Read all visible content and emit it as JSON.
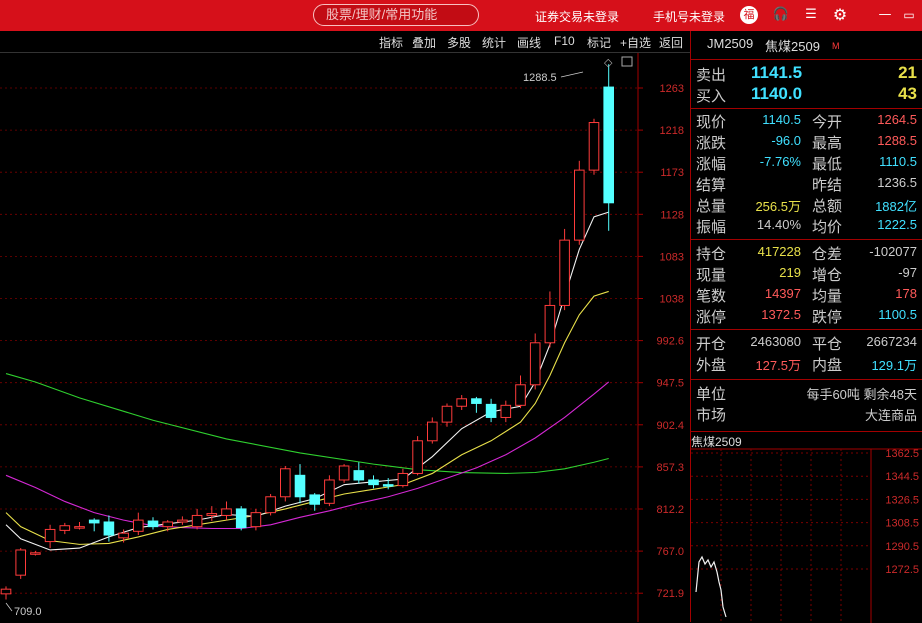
{
  "top": {
    "search": "股票/理财/常用功能",
    "link1": "证券交易未登录",
    "link2": "手机号未登录"
  },
  "toolbar": [
    "指标",
    "叠加",
    "多股",
    "统计",
    "画线",
    "F10",
    "标记",
    "+自选",
    "返回"
  ],
  "kchart": {
    "price_axis": [
      "1263",
      "1218",
      "1173",
      "1128",
      "1083",
      "1038",
      "992.6",
      "947.5",
      "902.4",
      "857.3",
      "812.2",
      "767.0",
      "721.9"
    ],
    "high_label": "1288.5",
    "low_label": "709.0",
    "candles": [
      [
        0,
        721,
        726,
        715,
        729
      ],
      [
        1,
        741,
        768,
        737,
        770
      ],
      [
        2,
        765,
        765,
        762,
        767
      ],
      [
        3,
        777,
        790,
        770,
        795
      ],
      [
        4,
        789,
        794,
        785,
        797
      ],
      [
        5,
        793,
        793,
        790,
        798
      ],
      [
        6,
        800,
        797,
        788,
        802
      ],
      [
        7,
        798,
        784,
        777,
        805
      ],
      [
        8,
        781,
        786,
        776,
        790
      ],
      [
        9,
        788,
        800,
        784,
        808
      ],
      [
        10,
        799,
        793,
        790,
        803
      ],
      [
        11,
        793,
        798,
        788,
        800
      ],
      [
        12,
        798,
        800,
        795,
        804
      ],
      [
        13,
        793,
        805,
        790,
        812
      ],
      [
        14,
        805,
        807,
        799,
        815
      ],
      [
        15,
        805,
        812,
        800,
        820
      ],
      [
        16,
        812,
        792,
        789,
        815
      ],
      [
        17,
        793,
        808,
        789,
        812
      ],
      [
        18,
        808,
        825,
        805,
        828
      ],
      [
        19,
        825,
        855,
        820,
        858
      ],
      [
        20,
        848,
        825,
        818,
        860
      ],
      [
        21,
        827,
        817,
        810,
        829
      ],
      [
        22,
        818,
        843,
        815,
        848
      ],
      [
        23,
        843,
        858,
        840,
        860
      ],
      [
        24,
        853,
        843,
        839,
        862
      ],
      [
        25,
        843,
        838,
        834,
        848
      ],
      [
        26,
        838,
        837,
        833,
        845
      ],
      [
        27,
        837,
        850,
        835,
        855
      ],
      [
        28,
        850,
        885,
        848,
        890
      ],
      [
        29,
        885,
        905,
        882,
        910
      ],
      [
        30,
        905,
        922,
        900,
        925
      ],
      [
        31,
        922,
        930,
        918,
        934
      ],
      [
        32,
        930,
        925,
        915,
        932
      ],
      [
        33,
        924,
        910,
        905,
        930
      ],
      [
        34,
        910,
        923,
        905,
        928
      ],
      [
        35,
        923,
        945,
        920,
        955
      ],
      [
        36,
        945,
        990,
        940,
        1000
      ],
      [
        37,
        990,
        1030,
        985,
        1045
      ],
      [
        38,
        1030,
        1100,
        1025,
        1112
      ],
      [
        39,
        1100,
        1175,
        1095,
        1185
      ],
      [
        40,
        1175,
        1226,
        1170,
        1230
      ],
      [
        41,
        1264,
        1140,
        1110,
        1288.5
      ]
    ],
    "ma_green": [
      [
        0,
        957
      ],
      [
        2,
        948
      ],
      [
        5,
        931
      ],
      [
        10,
        907
      ],
      [
        15,
        887
      ],
      [
        20,
        872
      ],
      [
        25,
        860
      ],
      [
        28,
        854
      ],
      [
        31,
        851
      ],
      [
        34,
        850
      ],
      [
        36,
        851
      ],
      [
        38,
        855
      ],
      [
        40,
        862
      ],
      [
        41,
        866
      ]
    ],
    "ma_magenta": [
      [
        0,
        848
      ],
      [
        2,
        835
      ],
      [
        4,
        820
      ],
      [
        6,
        808
      ],
      [
        8,
        800
      ],
      [
        10,
        794
      ],
      [
        12,
        792
      ],
      [
        14,
        791
      ],
      [
        16,
        791
      ],
      [
        18,
        795
      ],
      [
        20,
        803
      ],
      [
        22,
        810
      ],
      [
        24,
        818
      ],
      [
        26,
        825
      ],
      [
        28,
        834
      ],
      [
        30,
        845
      ],
      [
        32,
        856
      ],
      [
        34,
        870
      ],
      [
        36,
        888
      ],
      [
        38,
        910
      ],
      [
        40,
        935
      ],
      [
        41,
        948
      ]
    ],
    "ma_yellow": [
      [
        0,
        808
      ],
      [
        1,
        793
      ],
      [
        3,
        778
      ],
      [
        5,
        774
      ],
      [
        7,
        775
      ],
      [
        9,
        782
      ],
      [
        11,
        790
      ],
      [
        13,
        795
      ],
      [
        15,
        800
      ],
      [
        17,
        805
      ],
      [
        19,
        812
      ],
      [
        21,
        820
      ],
      [
        23,
        828
      ],
      [
        25,
        833
      ],
      [
        27,
        838
      ],
      [
        29,
        850
      ],
      [
        31,
        870
      ],
      [
        33,
        885
      ],
      [
        35,
        905
      ],
      [
        36,
        925
      ],
      [
        37,
        955
      ],
      [
        38,
        990
      ],
      [
        39,
        1020
      ],
      [
        40,
        1040
      ],
      [
        41,
        1045
      ]
    ],
    "ma_white": [
      [
        0,
        795
      ],
      [
        1,
        780
      ],
      [
        3,
        768
      ],
      [
        5,
        770
      ],
      [
        7,
        782
      ],
      [
        9,
        792
      ],
      [
        11,
        796
      ],
      [
        13,
        800
      ],
      [
        15,
        806
      ],
      [
        17,
        804
      ],
      [
        19,
        815
      ],
      [
        21,
        823
      ],
      [
        23,
        838
      ],
      [
        25,
        841
      ],
      [
        27,
        844
      ],
      [
        29,
        868
      ],
      [
        31,
        898
      ],
      [
        33,
        916
      ],
      [
        35,
        922
      ],
      [
        36,
        948
      ],
      [
        37,
        988
      ],
      [
        38,
        1040
      ],
      [
        39,
        1090
      ],
      [
        40,
        1125
      ],
      [
        41,
        1130
      ]
    ]
  },
  "quote": {
    "code": "JM2509",
    "name": "焦煤2509",
    "mark": "M",
    "sell_label": "卖出",
    "sell_price": "1141.5",
    "sell_vol": "21",
    "buy_label": "买入",
    "buy_price": "1140.0",
    "buy_vol": "43",
    "rows": [
      {
        "l1": "现价",
        "v1": "1140.5",
        "c1": "#40e0ff",
        "l2": "今开",
        "v2": "1264.5",
        "c2": "#ff5a5a"
      },
      {
        "l1": "涨跌",
        "v1": "-96.0",
        "c1": "#40e0ff",
        "l2": "最高",
        "v2": "1288.5",
        "c2": "#ff5a5a"
      },
      {
        "l1": "涨幅",
        "v1": "-7.76%",
        "c1": "#40e0ff",
        "l2": "最低",
        "v2": "1110.5",
        "c2": "#40e0ff"
      },
      {
        "l1": "结算",
        "v1": "",
        "c1": "#ccc",
        "l2": "昨结",
        "v2": "1236.5",
        "c2": "#ccc"
      },
      {
        "l1": "总量",
        "v1": "256.5万",
        "c1": "#e8e04a",
        "l2": "总额",
        "v2": "1882亿",
        "c2": "#40e0ff"
      },
      {
        "l1": "振幅",
        "v1": "14.40%",
        "c1": "#ccc",
        "l2": "均价",
        "v2": "1222.5",
        "c2": "#40e0ff"
      }
    ],
    "rows2": [
      {
        "l1": "持仓",
        "v1": "417228",
        "c1": "#e8e04a",
        "l2": "仓差",
        "v2": "-102077",
        "c2": "#ccc"
      },
      {
        "l1": "现量",
        "v1": "219",
        "c1": "#e8e04a",
        "l2": "增仓",
        "v2": "-97",
        "c2": "#ccc"
      },
      {
        "l1": "笔数",
        "v1": "14397",
        "c1": "#ff5a5a",
        "l2": "均量",
        "v2": "178",
        "c2": "#ff5a5a"
      },
      {
        "l1": "涨停",
        "v1": "1372.5",
        "c1": "#ff5a5a",
        "l2": "跌停",
        "v2": "1100.5",
        "c2": "#40e0ff"
      }
    ],
    "rows3": [
      {
        "l1": "开仓",
        "v1": "2463080",
        "c1": "#ccc",
        "l2": "平仓",
        "v2": "2667234",
        "c2": "#ccc"
      },
      {
        "l1": "外盘",
        "v1": "127.5万",
        "c1": "#ff5a5a",
        "l2": "内盘",
        "v2": "129.1万",
        "c2": "#40e0ff"
      }
    ],
    "unit_label": "单位",
    "unit_val": "每手60吨  剩余48天",
    "market_label": "市场",
    "market_val": "大连商品"
  },
  "mini": {
    "title": "焦煤2509",
    "axis": [
      "1362.5",
      "1344.5",
      "1326.5",
      "1308.5",
      "1290.5",
      "1272.5"
    ]
  }
}
